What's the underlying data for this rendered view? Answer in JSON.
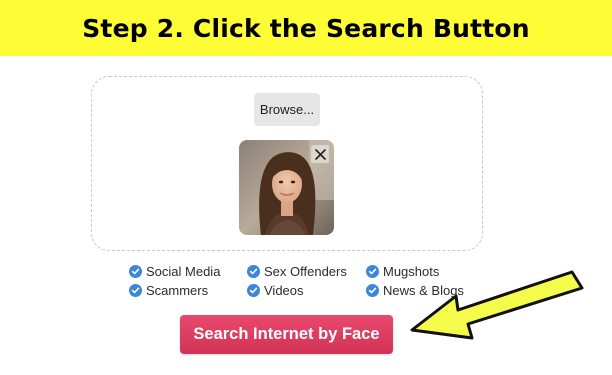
{
  "banner": {
    "title": "Step 2. Click the Search Button",
    "background": "#fdfc35"
  },
  "upload": {
    "browse_label": "Browse...",
    "remove_label": "×"
  },
  "features": [
    {
      "label": "Social Media"
    },
    {
      "label": "Sex Offenders"
    },
    {
      "label": "Mugshots"
    },
    {
      "label": "Scammers"
    },
    {
      "label": "Videos"
    },
    {
      "label": "News & Blogs"
    }
  ],
  "icons": {
    "check": "check-circle-icon",
    "arrow": "pointer-arrow-icon"
  },
  "search_button": {
    "label": "Search Internet by Face",
    "color": "#d63b5e"
  },
  "colors": {
    "accent_check": "#3d86d9",
    "arrow_fill": "#f4fb4a"
  }
}
